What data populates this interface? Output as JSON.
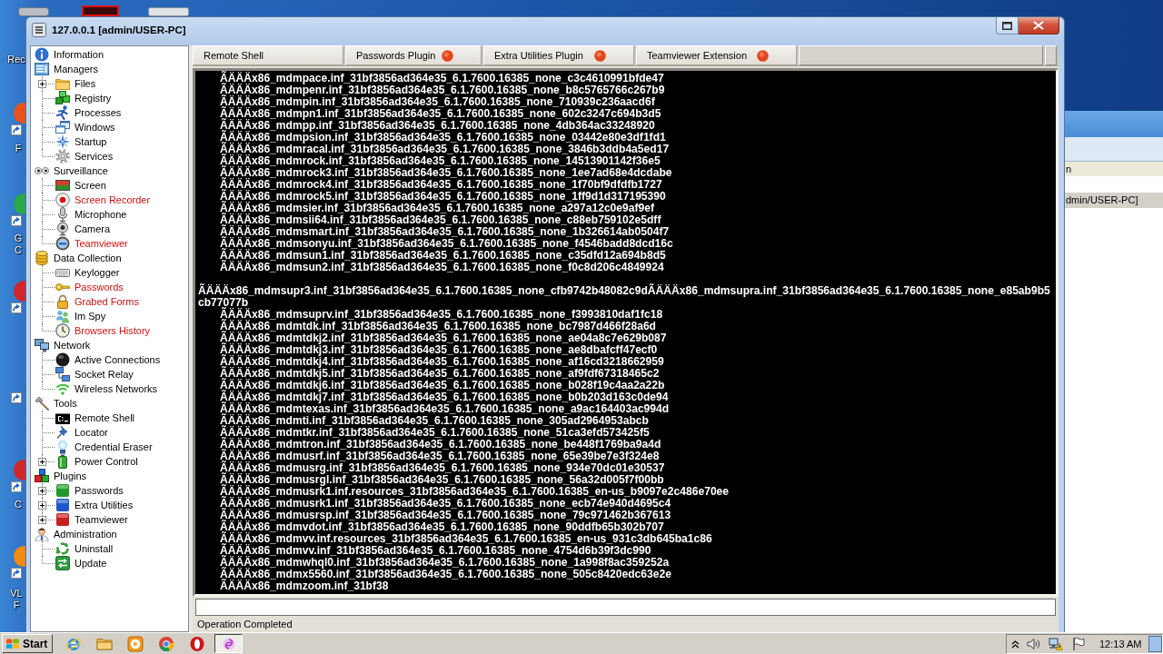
{
  "desktop": {
    "icons": [
      {
        "label": [
          "Rec"
        ]
      },
      {
        "label": [
          "F"
        ]
      },
      {
        "label": [
          "G",
          "C"
        ]
      },
      {
        "label": [
          "C"
        ]
      },
      {
        "label": [
          "VL",
          "F"
        ]
      }
    ]
  },
  "background_window": {
    "texts": [
      "n",
      "dmin/USER-PC]"
    ]
  },
  "window": {
    "title": "127.0.0.1 [admin/USER-PC]"
  },
  "tree": [
    {
      "label": "Information"
    },
    {
      "label": "Managers",
      "children": [
        {
          "label": "Files",
          "expanded": false
        },
        {
          "label": "Registry"
        },
        {
          "label": "Processes"
        },
        {
          "label": "Windows"
        },
        {
          "label": "Startup"
        },
        {
          "label": "Services"
        }
      ]
    },
    {
      "label": "Surveillance",
      "children": [
        {
          "label": "Screen"
        },
        {
          "label": "Screen Recorder",
          "color": "#d01010"
        },
        {
          "label": "Microphone"
        },
        {
          "label": "Camera"
        },
        {
          "label": "Teamviewer",
          "color": "#d01010"
        }
      ]
    },
    {
      "label": "Data Collection",
      "children": [
        {
          "label": "Keylogger"
        },
        {
          "label": "Passwords",
          "color": "#d01010"
        },
        {
          "label": "Grabed Forms",
          "color": "#d01010"
        },
        {
          "label": "Im Spy"
        },
        {
          "label": "Browsers History",
          "color": "#d01010"
        }
      ]
    },
    {
      "label": "Network",
      "children": [
        {
          "label": "Active Connections"
        },
        {
          "label": "Socket Relay"
        },
        {
          "label": "Wireless Networks"
        }
      ]
    },
    {
      "label": "Tools",
      "children": [
        {
          "label": "Remote Shell"
        },
        {
          "label": "Locator"
        },
        {
          "label": "Credential Eraser"
        },
        {
          "label": "Power Control",
          "expanded": false
        }
      ]
    },
    {
      "label": "Plugins",
      "children": [
        {
          "label": "Passwords",
          "expanded": false
        },
        {
          "label": "Extra Utilities",
          "expanded": false
        },
        {
          "label": "Teamviewer",
          "expanded": false
        }
      ]
    },
    {
      "label": "Administration",
      "children": [
        {
          "label": "Uninstall"
        },
        {
          "label": "Update"
        }
      ]
    }
  ],
  "tabs": [
    {
      "label": "Remote Shell",
      "kind": "tool"
    },
    {
      "label": "Passwords Plugin",
      "kind": "plugin"
    },
    {
      "label": "Extra Utilities Plugin",
      "kind": "plugin"
    },
    {
      "label": "Teamviewer Extension",
      "kind": "plugin"
    }
  ],
  "shell": {
    "blocks": [
      {
        "lines": [
          {
            "text": "ÃÄÄÄx86_mdmpace.inf_31bf3856ad364e35_6.1.7600.16385_none_c3c4610991bfde47",
            "indented": true
          },
          {
            "text": "ÃÄÄÄx86_mdmpenr.inf_31bf3856ad364e35_6.1.7600.16385_none_b8c5765766c267b9",
            "indented": true
          },
          {
            "text": "ÃÄÄÄx86_mdmpin.inf_31bf3856ad364e35_6.1.7600.16385_none_710939c236aacd6f",
            "indented": true
          },
          {
            "text": "ÃÄÄÄx86_mdmpn1.inf_31bf3856ad364e35_6.1.7600.16385_none_602c3247c694b3d5",
            "indented": true
          },
          {
            "text": "ÃÄÄÄx86_mdmpp.inf_31bf3856ad364e35_6.1.7600.16385_none_4db364ac33248920",
            "indented": true
          },
          {
            "text": "ÃÄÄÄx86_mdmpsion.inf_31bf3856ad364e35_6.1.7600.16385_none_03442e80e3df1fd1",
            "indented": true
          },
          {
            "text": "ÃÄÄÄx86_mdmracal.inf_31bf3856ad364e35_6.1.7600.16385_none_3846b3ddb4a5ed17",
            "indented": true
          },
          {
            "text": "ÃÄÄÄx86_mdmrock.inf_31bf3856ad364e35_6.1.7600.16385_none_14513901142f36e5",
            "indented": true
          },
          {
            "text": "ÃÄÄÄx86_mdmrock3.inf_31bf3856ad364e35_6.1.7600.16385_none_1ee7ad68e4dcdabe",
            "indented": true
          },
          {
            "text": "ÃÄÄÄx86_mdmrock4.inf_31bf3856ad364e35_6.1.7600.16385_none_1f70bf9dfdfb1727",
            "indented": true
          },
          {
            "text": "ÃÄÄÄx86_mdmrock5.inf_31bf3856ad364e35_6.1.7600.16385_none_1ff9d1d317195390",
            "indented": true
          },
          {
            "text": "ÃÄÄÄx86_mdmsier.inf_31bf3856ad364e35_6.1.7600.16385_none_a297a12c0e9af9ef",
            "indented": true
          },
          {
            "text": "ÃÄÄÄx86_mdmsii64.inf_31bf3856ad364e35_6.1.7600.16385_none_c88eb759102e5dff",
            "indented": true
          },
          {
            "text": "ÃÄÄÄx86_mdmsmart.inf_31bf3856ad364e35_6.1.7600.16385_none_1b326614ab0504f7",
            "indented": true
          },
          {
            "text": "ÃÄÄÄx86_mdmsonyu.inf_31bf3856ad364e35_6.1.7600.16385_none_f4546badd8dcd16c",
            "indented": true
          },
          {
            "text": "ÃÄÄÄx86_mdmsun1.inf_31bf3856ad364e35_6.1.7600.16385_none_c35dfd12a694b8d5",
            "indented": true
          },
          {
            "text": "ÃÄÄÄx86_mdmsun2.inf_31bf3856ad364e35_6.1.7600.16385_none_f0c8d206c4849924",
            "indented": true
          }
        ]
      },
      {
        "lines": [
          {
            "text": "ÃÄÄÄx86_mdmsupr3.inf_31bf3856ad364e35_6.1.7600.16385_none_cfb9742b48082c9dÃÄÄÄx86_mdmsupra.inf_31bf3856ad364e35_6.1.7600.16385_none_e85ab9b5cb77077b",
            "indented": false
          },
          {
            "text": "ÃÄÄÄx86_mdmsuprv.inf_31bf3856ad364e35_6.1.7600.16385_none_f3993810daf1fc18",
            "indented": true
          },
          {
            "text": "ÃÄÄÄx86_mdmtdk.inf_31bf3856ad364e35_6.1.7600.16385_none_bc7987d466f28a6d",
            "indented": true
          },
          {
            "text": "ÃÄÄÄx86_mdmtdkj2.inf_31bf3856ad364e35_6.1.7600.16385_none_ae04a8c7e629b087",
            "indented": true
          },
          {
            "text": "ÃÄÄÄx86_mdmtdkj3.inf_31bf3856ad364e35_6.1.7600.16385_none_ae8dbafcff47ecf0",
            "indented": true
          },
          {
            "text": "ÃÄÄÄx86_mdmtdkj4.inf_31bf3856ad364e35_6.1.7600.16385_none_af16cd3218662959",
            "indented": true
          },
          {
            "text": "ÃÄÄÄx86_mdmtdkj5.inf_31bf3856ad364e35_6.1.7600.16385_none_af9fdf67318465c2",
            "indented": true
          },
          {
            "text": "ÃÄÄÄx86_mdmtdkj6.inf_31bf3856ad364e35_6.1.7600.16385_none_b028f19c4aa2a22b",
            "indented": true
          },
          {
            "text": "ÃÄÄÄx86_mdmtdkj7.inf_31bf3856ad364e35_6.1.7600.16385_none_b0b203d163c0de94",
            "indented": true
          },
          {
            "text": "ÃÄÄÄx86_mdmtexas.inf_31bf3856ad364e35_6.1.7600.16385_none_a9ac164403ac994d",
            "indented": true
          },
          {
            "text": "ÃÄÄÄx86_mdmti.inf_31bf3856ad364e35_6.1.7600.16385_none_305ad2964953abcb",
            "indented": true
          },
          {
            "text": "ÃÄÄÄx86_mdmtkr.inf_31bf3856ad364e35_6.1.7600.16385_none_51ca3efd573425f5",
            "indented": true
          },
          {
            "text": "ÃÄÄÄx86_mdmtron.inf_31bf3856ad364e35_6.1.7600.16385_none_be448f1769ba9a4d",
            "indented": true
          },
          {
            "text": "ÃÄÄÄx86_mdmusrf.inf_31bf3856ad364e35_6.1.7600.16385_none_65e39be7e3f324e8",
            "indented": true
          },
          {
            "text": "ÃÄÄÄx86_mdmusrg.inf_31bf3856ad364e35_6.1.7600.16385_none_934e70dc01e30537",
            "indented": true
          },
          {
            "text": "ÃÄÄÄx86_mdmusrgl.inf_31bf3856ad364e35_6.1.7600.16385_none_56a32d005f7f00bb",
            "indented": true
          },
          {
            "text": "ÃÄÄÄx86_mdmusrk1.inf.resources_31bf3856ad364e35_6.1.7600.16385_en-us_b9097e2c486e70ee",
            "indented": true
          },
          {
            "text": "ÃÄÄÄx86_mdmusrk1.inf_31bf3856ad364e35_6.1.7600.16385_none_ecb74e940d4695c4",
            "indented": true
          },
          {
            "text": "ÃÄÄÄx86_mdmusrsp.inf_31bf3856ad364e35_6.1.7600.16385_none_79c971462b367613",
            "indented": true
          },
          {
            "text": "ÃÄÄÄx86_mdmvdot.inf_31bf3856ad364e35_6.1.7600.16385_none_90ddfb65b302b707",
            "indented": true
          },
          {
            "text": "ÃÄÄÄx86_mdmvv.inf.resources_31bf3856ad364e35_6.1.7600.16385_en-us_931c3db645ba1c86",
            "indented": true
          },
          {
            "text": "ÃÄÄÄx86_mdmvv.inf_31bf3856ad364e35_6.1.7600.16385_none_4754d6b39f3dc990",
            "indented": true
          },
          {
            "text": "ÃÄÄÄx86_mdmwhql0.inf_31bf3856ad364e35_6.1.7600.16385_none_1a998f8ac359252a",
            "indented": true
          },
          {
            "text": "ÃÄÄÄx86_mdmx5560.inf_31bf3856ad364e35_6.1.7600.16385_none_505c8420edc63e2e",
            "indented": true
          },
          {
            "text": "ÃÄÄÄx86_mdmzoom.inf_31bf38",
            "indented": true
          }
        ]
      }
    ]
  },
  "status_bar": {
    "text": "Operation Completed"
  },
  "taskbar": {
    "start": "Start",
    "clock": "12:13 AM"
  }
}
